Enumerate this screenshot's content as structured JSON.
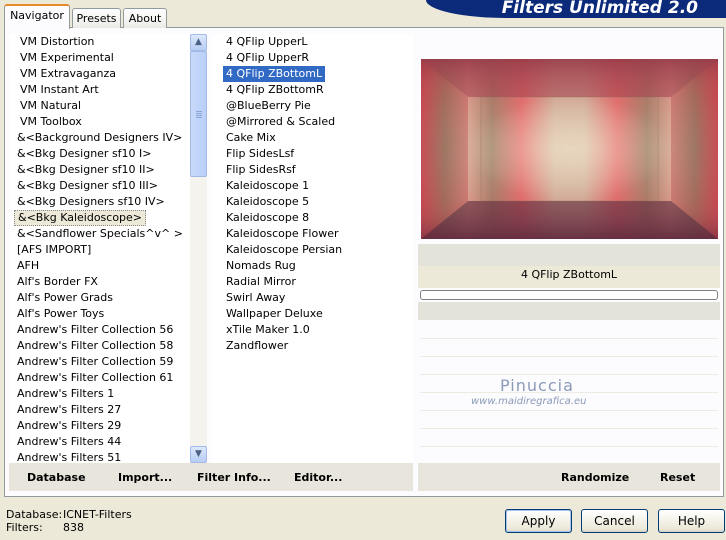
{
  "banner": {
    "title": "Filters Unlimited 2.0"
  },
  "tabs": [
    {
      "label": "Navigator",
      "active": true
    },
    {
      "label": "Presets",
      "active": false
    },
    {
      "label": "About",
      "active": false
    }
  ],
  "categories": {
    "items": [
      "VM Distortion",
      "VM Experimental",
      "VM Extravaganza",
      "VM Instant Art",
      "VM Natural",
      "VM Toolbox",
      "&<Background Designers IV>",
      "&<Bkg Designer sf10 I>",
      "&<Bkg Designer sf10 II>",
      "&<Bkg Designer sf10 III>",
      "&<Bkg Designers sf10 IV>",
      "&<Bkg Kaleidoscope>",
      "&<Sandflower Specials^v^ >",
      "[AFS IMPORT]",
      "AFH",
      "Alf's Border FX",
      "Alf's Power Grads",
      "Alf's Power Toys",
      "Andrew's Filter Collection 56",
      "Andrew's Filter Collection 58",
      "Andrew's Filter Collection 59",
      "Andrew's Filter Collection 61",
      "Andrew's Filters 1",
      "Andrew's Filters 27",
      "Andrew's Filters 29",
      "Andrew's Filters 44",
      "Andrew's Filters 51"
    ],
    "selected_index": 11
  },
  "filters": {
    "items": [
      "4 QFlip UpperL",
      "4 QFlip UpperR",
      "4 QFlip ZBottomL",
      "4 QFlip ZBottomR",
      "@BlueBerry Pie",
      "@Mirrored & Scaled",
      "Cake Mix",
      "Flip SidesLsf",
      "Flip SidesRsf",
      "Kaleidoscope 1",
      "Kaleidoscope 5",
      "Kaleidoscope 8",
      "Kaleidoscope Flower",
      "Kaleidoscope Persian",
      "Nomads Rug",
      "Radial Mirror",
      "Swirl Away",
      "Wallpaper Deluxe",
      "xTile Maker 1.0",
      "Zandflower"
    ],
    "selected_index": 2
  },
  "preview": {
    "filter_name": "4 QFlip ZBottomL",
    "progress": 0,
    "watermark_line1": "Pinuccia",
    "watermark_line2": "www.maidiregrafica.eu"
  },
  "left_buttons": [
    {
      "label": "Database"
    },
    {
      "label": "Import..."
    },
    {
      "label": "Filter Info..."
    },
    {
      "label": "Editor..."
    }
  ],
  "right_buttons": [
    {
      "label": "Randomize"
    },
    {
      "label": "Reset"
    }
  ],
  "status": {
    "database_label": "Database:",
    "database_value": "ICNET-Filters",
    "filters_label": "Filters:",
    "filters_value": "838"
  },
  "dialog_buttons": {
    "apply": "Apply",
    "cancel": "Cancel",
    "help": "Help"
  },
  "icons": {
    "scroll_up": "chevron-up-icon",
    "scroll_down": "chevron-down-icon"
  }
}
